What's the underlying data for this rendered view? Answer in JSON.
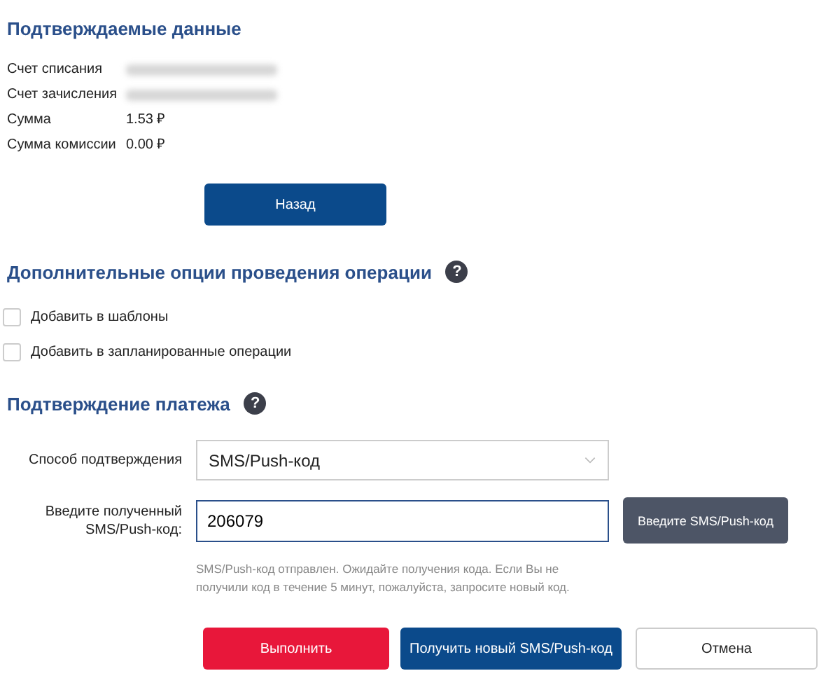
{
  "confirm_section": {
    "title": "Подтверждаемые данные",
    "rows": [
      {
        "label": "Счет списания",
        "kind": "redacted"
      },
      {
        "label": "Счет зачисления",
        "kind": "redacted"
      },
      {
        "label": "Сумма",
        "kind": "text",
        "value": "1.53 ₽"
      },
      {
        "label": "Сумма комиссии",
        "kind": "text",
        "value": "0.00 ₽"
      }
    ],
    "back_button": "Назад"
  },
  "options_section": {
    "title": "Дополнительные опции проведения операции",
    "help_icon": "?",
    "options": [
      {
        "label": "Добавить в шаблоны",
        "checked": false
      },
      {
        "label": "Добавить в запланированные операции",
        "checked": false
      }
    ]
  },
  "payment_section": {
    "title": "Подтверждение платежа",
    "help_icon": "?",
    "method_label": "Способ подтверждения",
    "method_value": "SMS/Push-код",
    "code_label": "Введите полученный SMS/Push-код:",
    "code_value": "206079",
    "code_button": "Введите SMS/Push-код",
    "hint": "SMS/Push-код отправлен. Ожидайте получения кода. Если Вы не получили код в течение 5 минут, пожалуйста, запросите новый код."
  },
  "actions": [
    {
      "label": "Выполнить",
      "kind": "primary"
    },
    {
      "label": "Получить новый SMS/Push-код",
      "kind": "secondary"
    },
    {
      "label": "Отмена",
      "kind": "plain"
    }
  ]
}
